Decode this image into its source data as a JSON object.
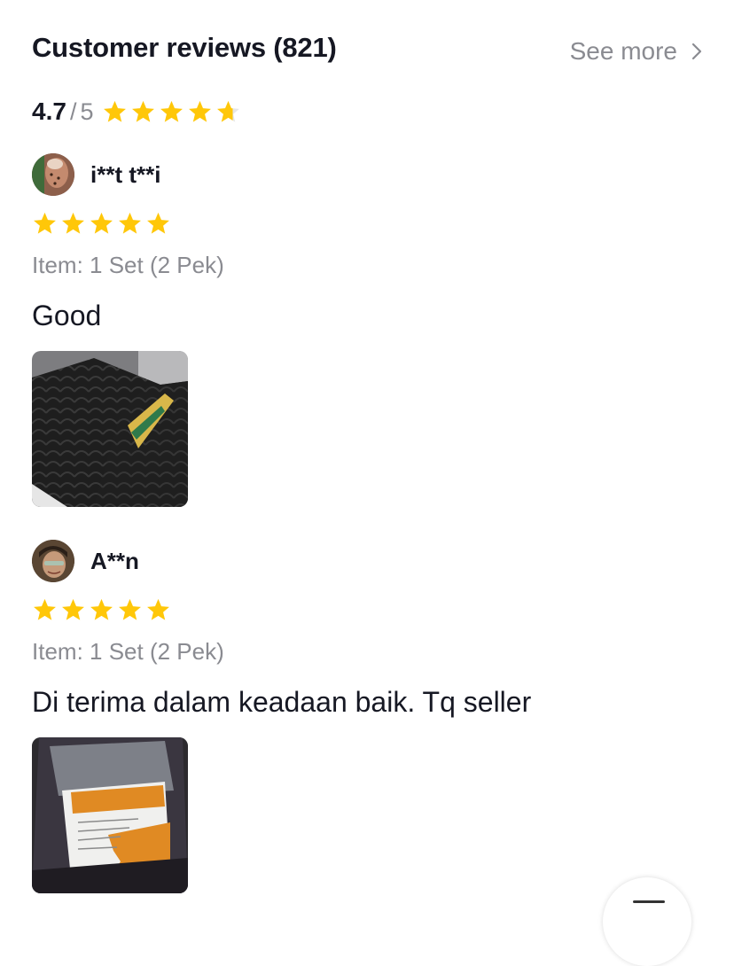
{
  "header": {
    "title": "Customer reviews (821)",
    "see_more": "See more",
    "chevron_icon": "chevron-right-icon"
  },
  "summary": {
    "score": "4.7",
    "slash": "/",
    "max": "5",
    "stars_value": 4.7,
    "star_color": "#FFC709"
  },
  "reviews": [
    {
      "username": "i**t t**i",
      "stars": 5,
      "item": "Item: 1 Set (2 Pek)",
      "text": "Good",
      "avatar": "user-avatar",
      "photo": "black-bubble-mailer-photo"
    },
    {
      "username": "A**n",
      "stars": 5,
      "item": "Item: 1 Set (2 Pek)",
      "text": "Di terima dalam keadaan baik. Tq seller",
      "avatar": "user-avatar",
      "photo": "package-label-photo"
    }
  ],
  "colors": {
    "text_primary": "#161823",
    "text_secondary": "#8a8b91",
    "star": "#FFC709"
  }
}
